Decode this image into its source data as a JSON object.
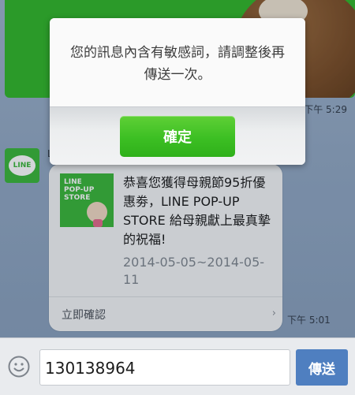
{
  "chat": {
    "sticker_time": "下午 5:29",
    "sender_avatar_label": "LINE",
    "sender_name": "L",
    "message_time": "下午 5:01",
    "card": {
      "thumbnail_text": "LINE\nPOP-UP\nSTORE",
      "title": "恭喜您獲得母親節95折優惠劵，LINE POP-UP STORE 給母親獻上最真摯的祝福!",
      "date": "2014-05-05~2014-05-11",
      "action_label": "立即確認",
      "action_icon": "chevron-right-icon"
    }
  },
  "dialog": {
    "message": "您的訊息內含有敏感詞，請調整後再傳送一次。",
    "ok_label": "確定"
  },
  "input_bar": {
    "emoji_icon": "smiley-icon",
    "input_value": "130138964",
    "send_label": "傳送"
  },
  "colors": {
    "line_green": "#3bb73a",
    "send_blue": "#4f7fc0"
  }
}
